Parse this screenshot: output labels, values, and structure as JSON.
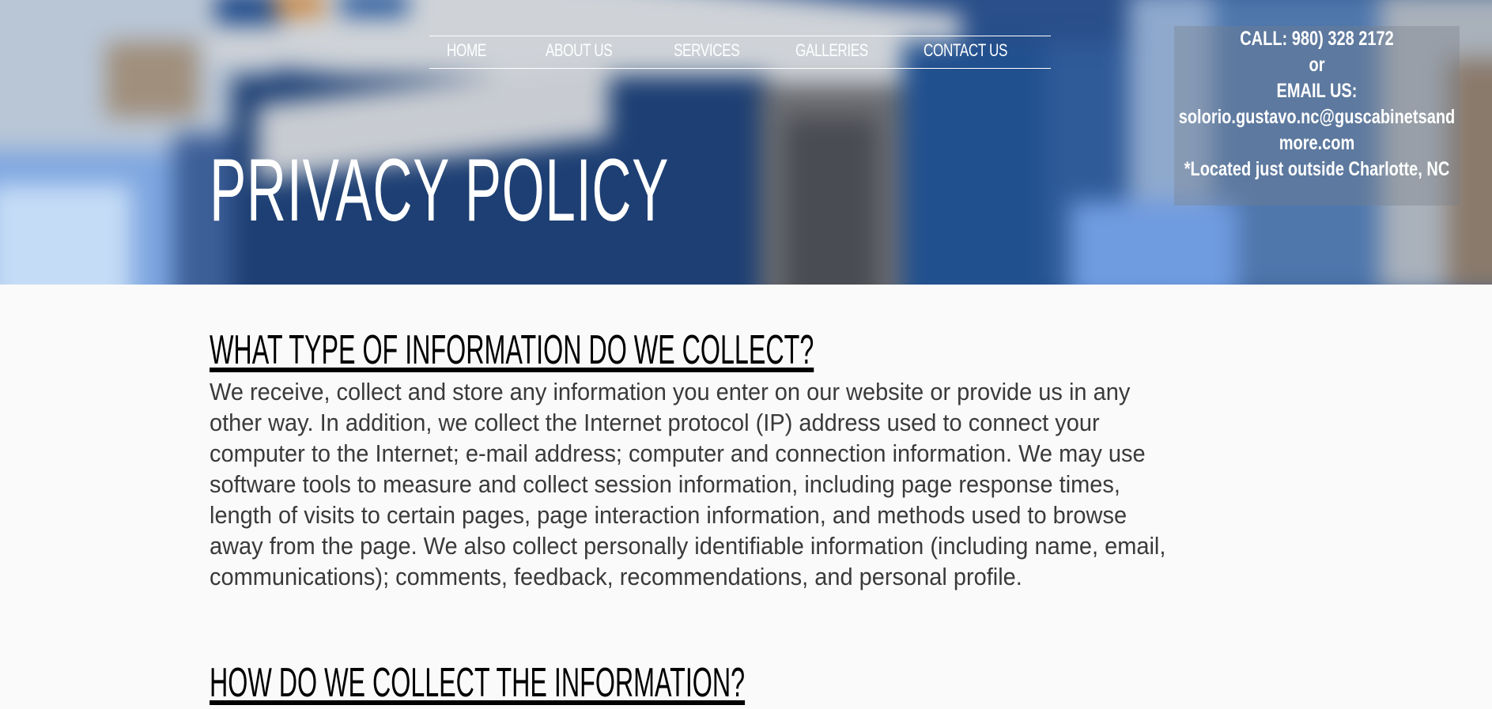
{
  "nav": {
    "items": [
      {
        "label": "HOME"
      },
      {
        "label": "ABOUT US"
      },
      {
        "label": "SERVICES"
      },
      {
        "label": "GALLERIES"
      },
      {
        "label": "CONTACT US"
      }
    ]
  },
  "contact": {
    "lines": [
      "CALL: 980) 328 2172",
      "or",
      "EMAIL US:",
      "solorio.gustavo.nc@guscabinetsand",
      "more.com",
      "*Located just outside Charlotte, NC"
    ]
  },
  "hero": {
    "title": "PRIVACY POLICY"
  },
  "sections": [
    {
      "heading": "WHAT TYPE OF INFORMATION DO WE COLLECT?",
      "body_lines": [
        "We receive, collect and store any information you enter on our website or provide us in any",
        "other way. In addition, we collect the Internet protocol (IP) address used to connect your",
        "computer to the Internet; e-mail address; computer and connection information. We may use",
        "software tools to measure and collect session information, including page response times,",
        "length of visits to certain pages, page interaction information, and methods used to browse",
        "away from the page. We also collect personally identifiable information (including name, email,",
        "communications); comments, feedback, recommendations, and personal profile."
      ]
    },
    {
      "heading": "HOW DO WE COLLECT THE INFORMATION?"
    }
  ]
}
